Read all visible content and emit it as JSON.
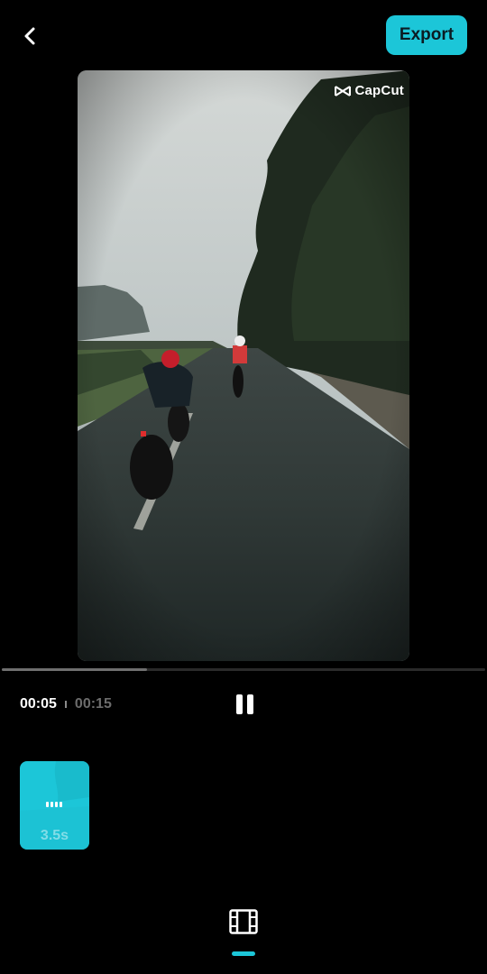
{
  "header": {
    "back_icon": "chevron-left-icon",
    "export_label": "Export"
  },
  "preview": {
    "watermark_text": "CapCut",
    "watermark_icon": "capcut-logo-icon"
  },
  "playback": {
    "current_time": "00:05",
    "total_time": "00:15",
    "progress_fraction": 0.3,
    "pause_icon": "pause-icon"
  },
  "timeline": {
    "clips": [
      {
        "duration": "3.5s"
      }
    ]
  },
  "bottom_tabs": [
    {
      "icon": "film-strip-icon",
      "active": true
    }
  ],
  "colors": {
    "accent": "#1cc6d8",
    "background": "#000000",
    "time_secondary": "#6c6c6c"
  }
}
